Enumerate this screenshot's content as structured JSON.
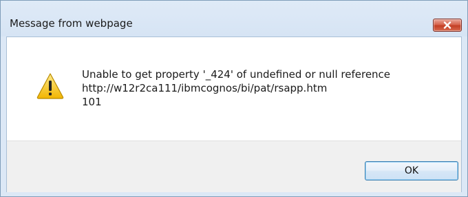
{
  "window": {
    "title": "Message from webpage"
  },
  "message": {
    "line1": "Unable to get property '_424' of undefined or null reference",
    "line2": "http://w12r2ca111/ibmcognos/bi/pat/rsapp.htm",
    "line3": "101"
  },
  "buttons": {
    "ok_label": "OK"
  },
  "icons": {
    "close": "close-icon",
    "warning": "warning-icon"
  },
  "colors": {
    "close_button": "#c33f25",
    "warning_yellow": "#f7c61c",
    "titlebar": "#dce8f6",
    "button_bar": "#f0f0f0"
  }
}
